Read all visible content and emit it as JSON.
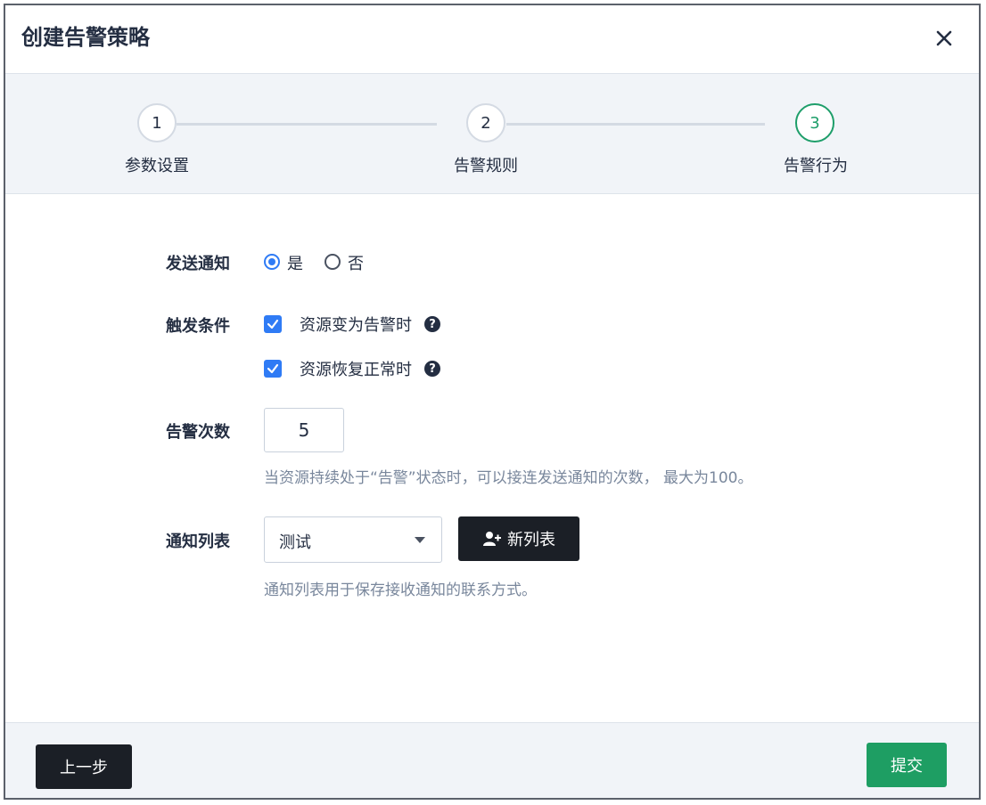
{
  "dialog": {
    "title": "创建告警策略",
    "close_icon": "close-icon"
  },
  "steps": [
    {
      "number": "1",
      "label": "参数设置",
      "state": "done"
    },
    {
      "number": "2",
      "label": "告警规则",
      "state": "done"
    },
    {
      "number": "3",
      "label": "告警行为",
      "state": "active"
    }
  ],
  "form": {
    "send_notification": {
      "label": "发送通知",
      "options": [
        {
          "text": "是",
          "selected": true
        },
        {
          "text": "否",
          "selected": false
        }
      ]
    },
    "trigger": {
      "label": "触发条件",
      "options": [
        {
          "text": "资源变为告警时",
          "checked": true
        },
        {
          "text": "资源恢复正常时",
          "checked": true
        }
      ],
      "help_icon": "help-icon"
    },
    "alert_count": {
      "label": "告警次数",
      "value": "5",
      "hint": "当资源持续处于“告警”状态时，可以接连发送通知的次数， 最大为100。"
    },
    "notify_list": {
      "label": "通知列表",
      "selected": "测试",
      "new_button": "新列表",
      "hint": "通知列表用于保存接收通知的联系方式。"
    }
  },
  "footer": {
    "prev_button": "上一步",
    "submit_button": "提交"
  },
  "colors": {
    "accent_green": "#1e9e63",
    "accent_blue": "#2f7bf5",
    "dark_button": "#1b1f26"
  }
}
